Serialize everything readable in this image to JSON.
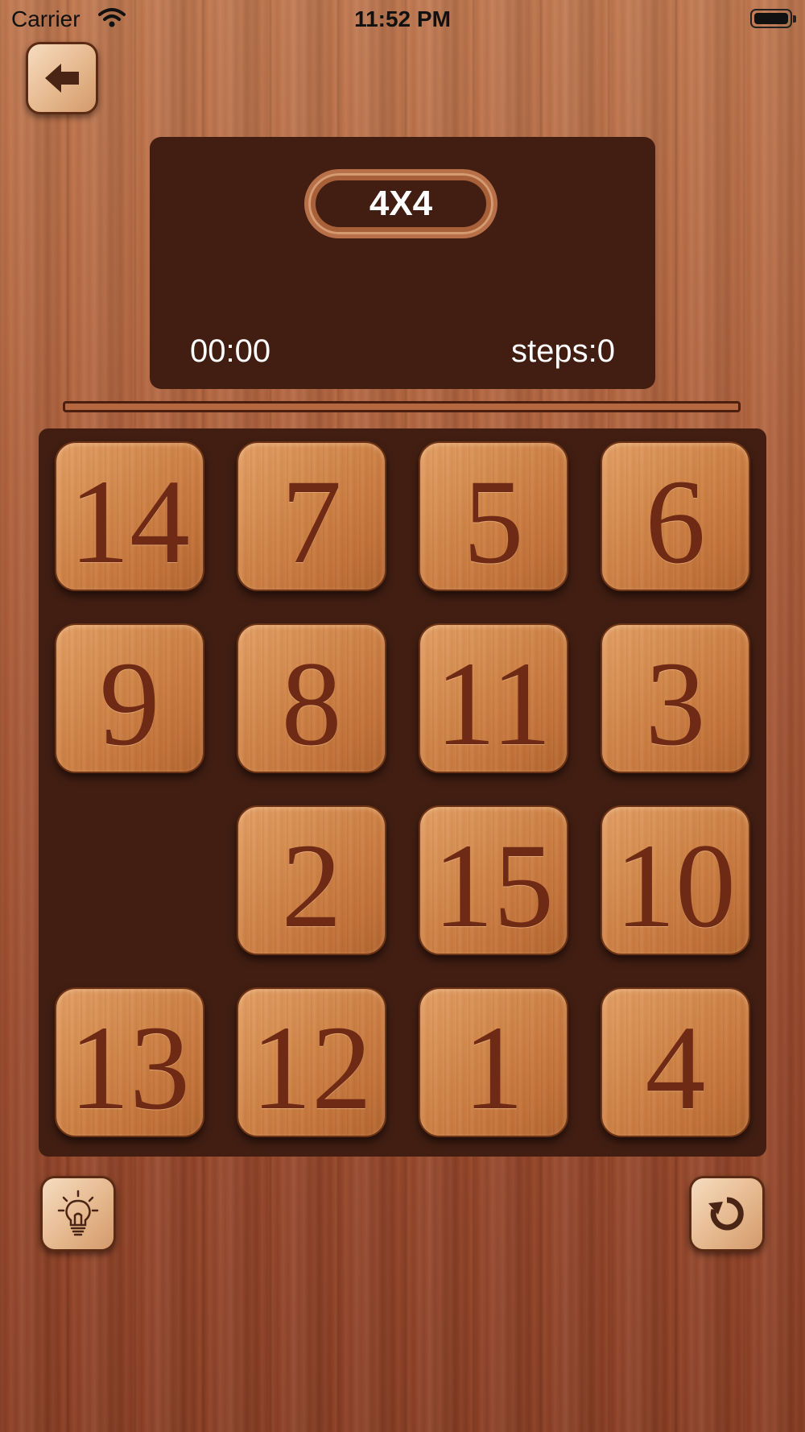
{
  "status_bar": {
    "carrier": "Carrier",
    "time": "11:52 PM"
  },
  "info": {
    "mode": "4X4",
    "timer": "00:00",
    "steps": "steps:0"
  },
  "board": {
    "tiles": [
      [
        "14",
        "7",
        "5",
        "6"
      ],
      [
        "9",
        "8",
        "11",
        "3"
      ],
      [
        "",
        "2",
        "15",
        "10"
      ],
      [
        "13",
        "12",
        "1",
        "4"
      ]
    ]
  },
  "icons": {
    "back": "arrow-left-icon",
    "hint": "lightbulb-icon",
    "reset": "reset-icon"
  }
}
